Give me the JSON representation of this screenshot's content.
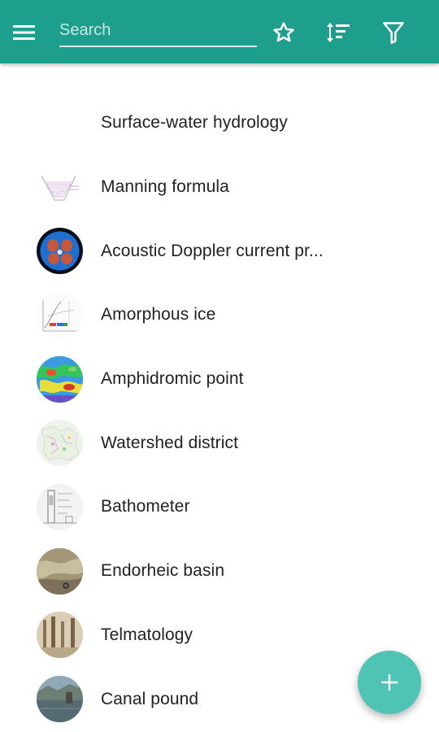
{
  "toolbar": {
    "menu_icon": "menu-icon",
    "search_placeholder": "Search",
    "search_value": "",
    "actions": [
      "star-icon",
      "sort-icon",
      "filter-icon"
    ],
    "accent_color": "#1e9e8d"
  },
  "items": [
    {
      "label": "Surface-water hydrology",
      "thumb": "none"
    },
    {
      "label": "Manning formula",
      "thumb": "channel-diagram"
    },
    {
      "label": "Acoustic Doppler current pr...",
      "thumb": "doppler-instrument"
    },
    {
      "label": "Amorphous ice",
      "thumb": "phase-diagram"
    },
    {
      "label": "Amphidromic point",
      "thumb": "tidal-map"
    },
    {
      "label": "Watershed district",
      "thumb": "district-map"
    },
    {
      "label": "Bathometer",
      "thumb": "instrument-drawing"
    },
    {
      "label": "Endorheic basin",
      "thumb": "basin-photo"
    },
    {
      "label": "Telmatology",
      "thumb": "wetland-photo"
    },
    {
      "label": "Canal pound",
      "thumb": "canal-photo"
    }
  ],
  "fab": {
    "icon": "add-icon",
    "color": "#4fc3b4"
  }
}
